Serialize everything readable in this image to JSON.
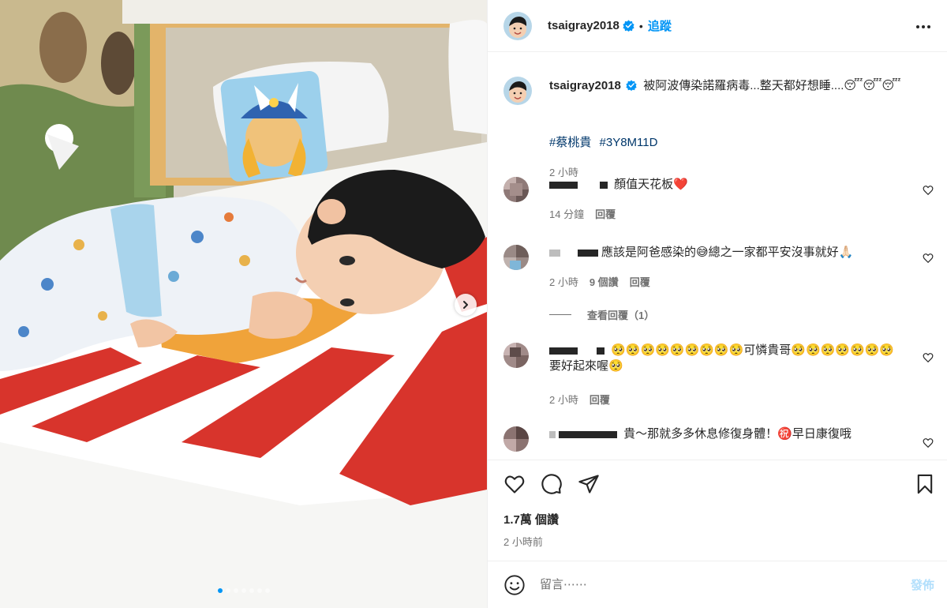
{
  "post": {
    "username": "tsaigray2018",
    "follow_label": "追蹤",
    "separator": "•"
  },
  "caption": {
    "username": "tsaigray2018",
    "text": "被阿波傳染諾羅病毒...整天都好想睡....😴😴😴",
    "hashtags": [
      "#蔡桃貴",
      "#3Y8M11D"
    ],
    "time": "2 小時"
  },
  "comments": [
    {
      "text": "顏值天花板❤️",
      "meta": [
        "14 分鐘",
        "回覆"
      ]
    },
    {
      "text": "應該是阿爸感染的😅總之一家都平安沒事就好🙏🏻",
      "meta": [
        "2 小時",
        "9 個讚",
        "回覆"
      ],
      "view_replies": "查看回覆（1）"
    },
    {
      "text": "🥺🥺🥺🥺🥺🥺🥺🥺🥺可憐貴哥🥺🥺🥺🥺🥺🥺🥺要好起來喔🥺",
      "meta": [
        "2 小時",
        "回覆"
      ]
    },
    {
      "text": "貴～那就多多休息修復身體！㊗️早日康復哦",
      "meta": []
    }
  ],
  "stats": {
    "views": "1.7萬 個讚",
    "time": "2 小時前"
  },
  "composer": {
    "placeholder": "留言⋯⋯",
    "post_label": "發佈"
  },
  "carousel": {
    "total": 7,
    "active": 0
  },
  "colors": {
    "accent": "#0095f6",
    "verified": "#0095f6",
    "hashtag": "#00376b",
    "muted": "#737373"
  },
  "icons": [
    "more-icon",
    "verified-icon",
    "heart-icon",
    "comment-icon",
    "share-icon",
    "bookmark-icon",
    "emoji-icon",
    "chevron-right-icon"
  ]
}
